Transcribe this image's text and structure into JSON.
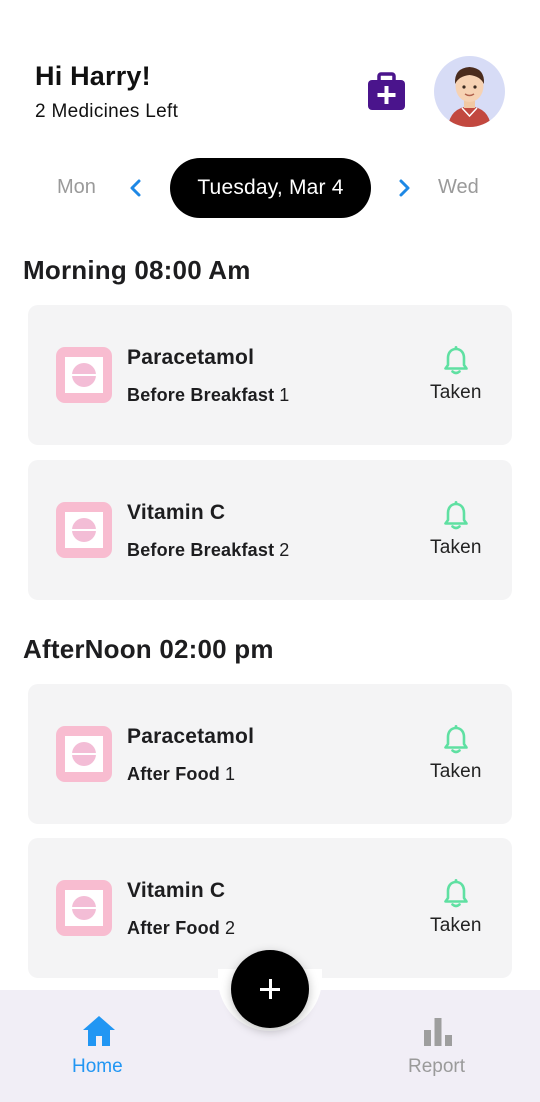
{
  "header": {
    "greeting": "Hi Harry!",
    "subtitle": "2 Medicines Left",
    "kit_icon": "medical-kit-icon",
    "avatar": "user-avatar"
  },
  "datebar": {
    "prev_day": "Mon",
    "current_date": "Tuesday, Mar 4",
    "next_day": "Wed"
  },
  "sections": [
    {
      "title": "Morning 08:00 Am",
      "items": [
        {
          "name": "Paracetamol",
          "when": "Before Breakfast",
          "qty": "1",
          "status": "Taken"
        },
        {
          "name": "Vitamin C",
          "when": "Before Breakfast",
          "qty": "2",
          "status": "Taken"
        }
      ]
    },
    {
      "title": "AfterNoon 02:00 pm",
      "items": [
        {
          "name": "Paracetamol",
          "when": "After Food",
          "qty": "1",
          "status": "Taken"
        },
        {
          "name": "Vitamin C",
          "when": "After Food",
          "qty": "2",
          "status": "Taken"
        }
      ]
    }
  ],
  "bottom_nav": {
    "home_label": "Home",
    "report_label": "Report",
    "fab_icon": "plus-icon"
  },
  "colors": {
    "accent": "#2196f3",
    "bell": "#5fe0a2",
    "kit": "#4a148c",
    "pill": "#f8bcd0",
    "card": "#f4f4f5"
  }
}
